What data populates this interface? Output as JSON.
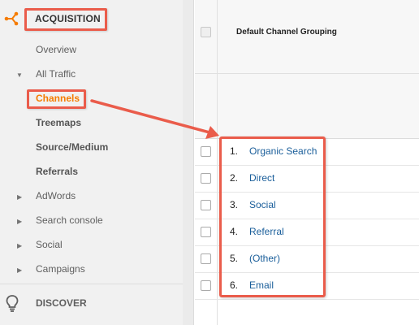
{
  "sidebar": {
    "section_title": "ACQUISITION",
    "items": [
      {
        "label": "Overview"
      },
      {
        "label": "All Traffic"
      },
      {
        "label": "Channels"
      },
      {
        "label": "Treemaps"
      },
      {
        "label": "Source/Medium"
      },
      {
        "label": "Referrals"
      },
      {
        "label": "AdWords"
      },
      {
        "label": "Search console"
      },
      {
        "label": "Social"
      },
      {
        "label": "Campaigns"
      }
    ],
    "discover_label": "DISCOVER",
    "accent_color": "#f57c00"
  },
  "table": {
    "column_header": "Default Channel Grouping",
    "rows": [
      {
        "index": "1.",
        "channel": "Organic Search"
      },
      {
        "index": "2.",
        "channel": "Direct"
      },
      {
        "index": "3.",
        "channel": "Social"
      },
      {
        "index": "4.",
        "channel": "Referral"
      },
      {
        "index": "5.",
        "channel": "(Other)"
      },
      {
        "index": "6.",
        "channel": "Email"
      }
    ],
    "link_color": "#1a5e9a"
  },
  "annotation": {
    "highlight_color": "#ea5c4b"
  }
}
